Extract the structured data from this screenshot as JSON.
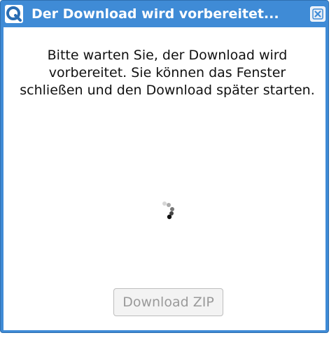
{
  "dialog": {
    "title": "Der Download wird vorbereitet...",
    "logo_icon": "app-logo-q-icon",
    "close_icon": "close-icon",
    "message": "Bitte warten Sie, der Download wird vorbereitet. Sie können das Fenster schließen und den Download später starten.",
    "spinner_icon": "loading-spinner-icon",
    "download_button_label": "Download ZIP",
    "download_button_enabled": false
  },
  "colors": {
    "titlebar": "#3f8bd6",
    "title_text": "#ffffff",
    "button_disabled_text": "#9a9a9a"
  }
}
